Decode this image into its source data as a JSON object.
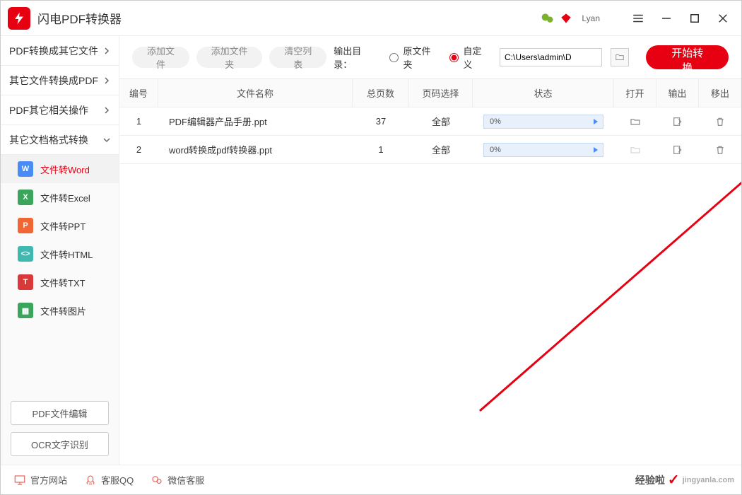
{
  "app": {
    "title": "闪电PDF转换器",
    "user": "Lyan"
  },
  "sidebar": {
    "cats": [
      {
        "label": "PDF转换成其它文件"
      },
      {
        "label": "其它文件转换成PDF"
      },
      {
        "label": "PDF其它相关操作"
      },
      {
        "label": "其它文档格式转换"
      }
    ],
    "subs": [
      {
        "label": "文件转Word",
        "letter": "W"
      },
      {
        "label": "文件转Excel",
        "letter": "X"
      },
      {
        "label": "文件转PPT",
        "letter": "P"
      },
      {
        "label": "文件转HTML",
        "letter": "<>"
      },
      {
        "label": "文件转TXT",
        "letter": "T"
      },
      {
        "label": "文件转图片",
        "letter": "▦"
      }
    ],
    "bottom": [
      {
        "label": "PDF文件编辑"
      },
      {
        "label": "OCR文字识别"
      }
    ]
  },
  "toolbar": {
    "add_file": "添加文件",
    "add_folder": "添加文件夹",
    "clear": "清空列表",
    "out_label": "输出目录：",
    "radio_orig": "原文件夹",
    "radio_custom": "自定义",
    "path": "C:\\Users\\admin\\D",
    "start": "开始转换"
  },
  "table": {
    "headers": {
      "id": "编号",
      "name": "文件名称",
      "pages": "总页数",
      "sel": "页码选择",
      "status": "状态",
      "open": "打开",
      "out": "输出",
      "rm": "移出"
    },
    "rows": [
      {
        "id": "1",
        "name": "PDF编辑器产品手册.ppt",
        "pages": "37",
        "sel": "全部",
        "progress": "0%"
      },
      {
        "id": "2",
        "name": "word转换成pdf转换器.ppt",
        "pages": "1",
        "sel": "全部",
        "progress": "0%"
      }
    ]
  },
  "footer": {
    "site": "官方网站",
    "qq": "客服QQ",
    "wechat": "微信客服"
  },
  "watermark": {
    "text1": "经验啦",
    "text2": "jingyanla.com"
  }
}
